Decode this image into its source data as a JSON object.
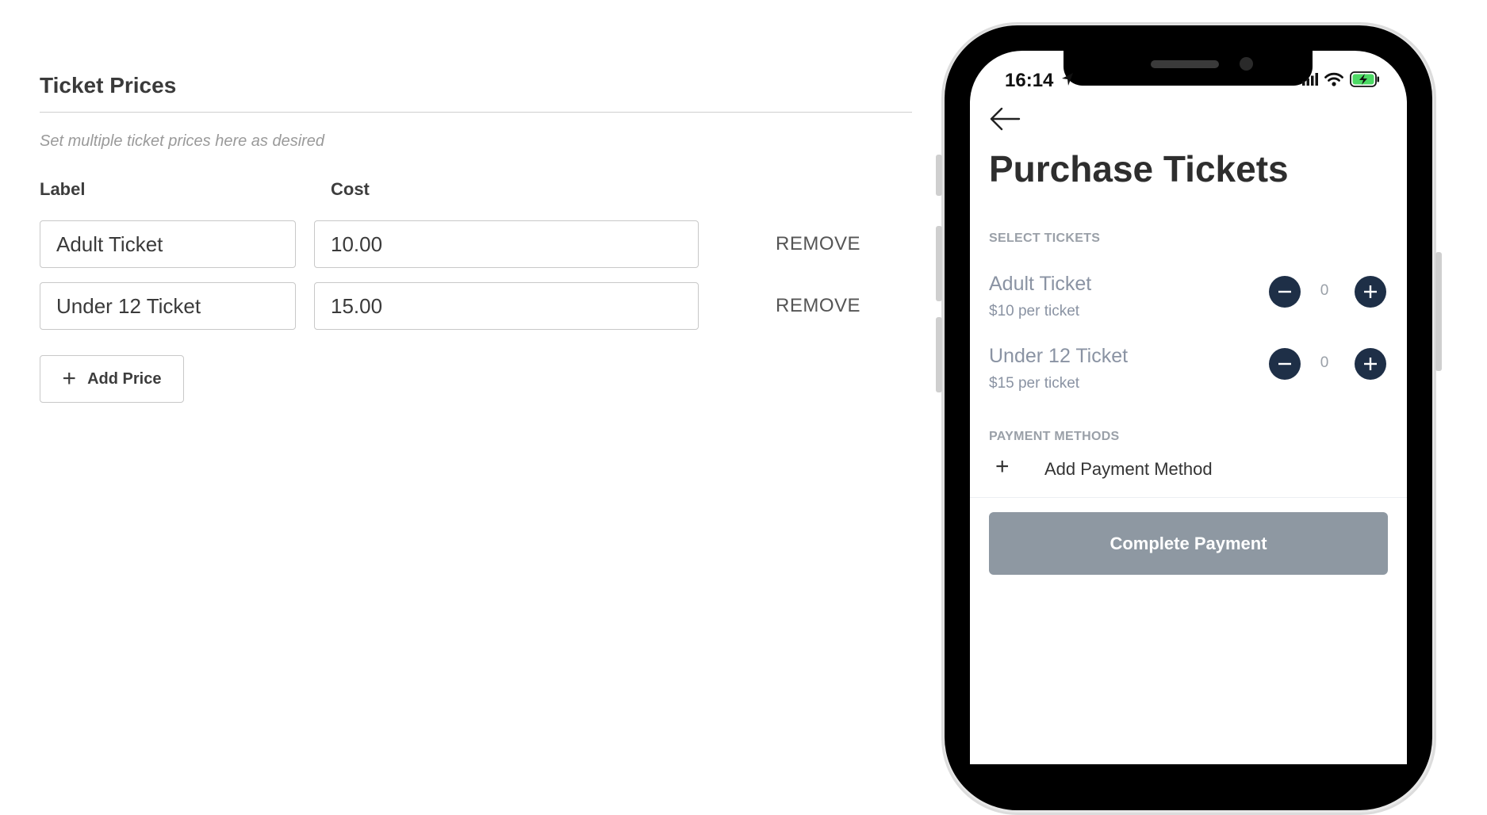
{
  "ticket_prices": {
    "title": "Ticket Prices",
    "help_text": "Set multiple ticket prices here as desired",
    "label_header": "Label",
    "cost_header": "Cost",
    "rows": [
      {
        "label": "Adult Ticket",
        "cost": "10.00",
        "remove": "REMOVE"
      },
      {
        "label": "Under 12 Ticket",
        "cost": "15.00",
        "remove": "REMOVE"
      }
    ],
    "add_price_label": "Add Price"
  },
  "phone": {
    "status_time": "16:14",
    "page_title": "Purchase Tickets",
    "select_tickets_label": "SELECT TICKETS",
    "tickets": [
      {
        "name": "Adult Ticket",
        "price": "$10 per ticket",
        "quantity": "0"
      },
      {
        "name": "Under 12 Ticket",
        "price": "$15 per ticket",
        "quantity": "0"
      }
    ],
    "payment_methods_label": "PAYMENT METHODS",
    "add_payment_label": "Add Payment Method",
    "complete_payment_label": "Complete Payment"
  },
  "colors": {
    "stepper": "#1e2f47",
    "complete_button_disabled": "#8e98a2",
    "battery_fill": "#4cd964"
  },
  "icons": [
    "plus-icon",
    "back-arrow-icon",
    "minus-icon",
    "location-arrow-icon",
    "signal-icon",
    "wifi-icon",
    "battery-charging-icon"
  ]
}
